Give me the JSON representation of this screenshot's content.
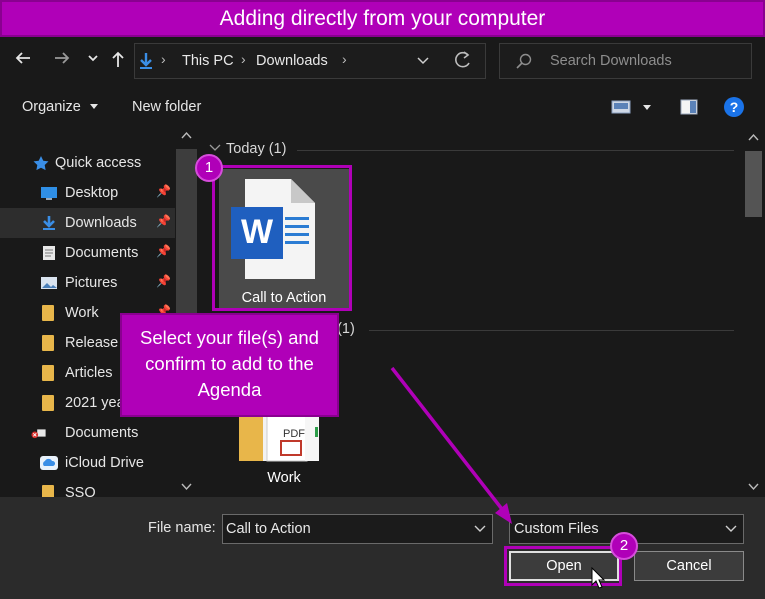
{
  "banner": {
    "title": "Adding directly from your computer"
  },
  "nav": {
    "back_icon": "arrow-left",
    "forward_icon": "arrow-right",
    "recent_icon": "chevron-down",
    "up_icon": "arrow-up",
    "breadcrumb": [
      "This PC",
      "Downloads"
    ],
    "search_placeholder": "Search Downloads"
  },
  "toolbar": {
    "organize": "Organize",
    "new_folder": "New folder"
  },
  "sidebar": {
    "items": [
      {
        "label": "Quick access",
        "icon": "star-icon"
      },
      {
        "label": "Desktop",
        "icon": "desktop-icon",
        "pinned": true
      },
      {
        "label": "Downloads",
        "icon": "download-icon",
        "pinned": true,
        "selected": true
      },
      {
        "label": "Documents",
        "icon": "documents-icon",
        "pinned": true
      },
      {
        "label": "Pictures",
        "icon": "pictures-icon",
        "pinned": true
      },
      {
        "label": "Work",
        "icon": "folder-icon",
        "pinned": true
      },
      {
        "label": "Release",
        "icon": "folder-icon"
      },
      {
        "label": "Articles",
        "icon": "folder-icon"
      },
      {
        "label": "2021 yea",
        "icon": "folder-icon"
      },
      {
        "label": "Documents",
        "icon": "error-folder-icon"
      },
      {
        "label": "iCloud Drive",
        "icon": "cloud-icon"
      },
      {
        "label": "SSO",
        "icon": "folder-icon"
      }
    ]
  },
  "files": {
    "groups": [
      {
        "header": "Today (1)",
        "items": [
          {
            "name": "Call to Action",
            "type": "word-document",
            "selected": true
          }
        ]
      },
      {
        "header": "n (1)",
        "items": [
          {
            "name": "Work",
            "type": "folder"
          }
        ]
      }
    ]
  },
  "bottom": {
    "file_name_label": "File name:",
    "file_name_value": "Call to Action",
    "file_type_value": "Custom Files",
    "open_label": "Open",
    "cancel_label": "Cancel"
  },
  "annotations": {
    "callout_text": "Select your file(s) and confirm to add to the Agenda",
    "step1": "1",
    "step2": "2",
    "accent_color": "#b000b8"
  }
}
